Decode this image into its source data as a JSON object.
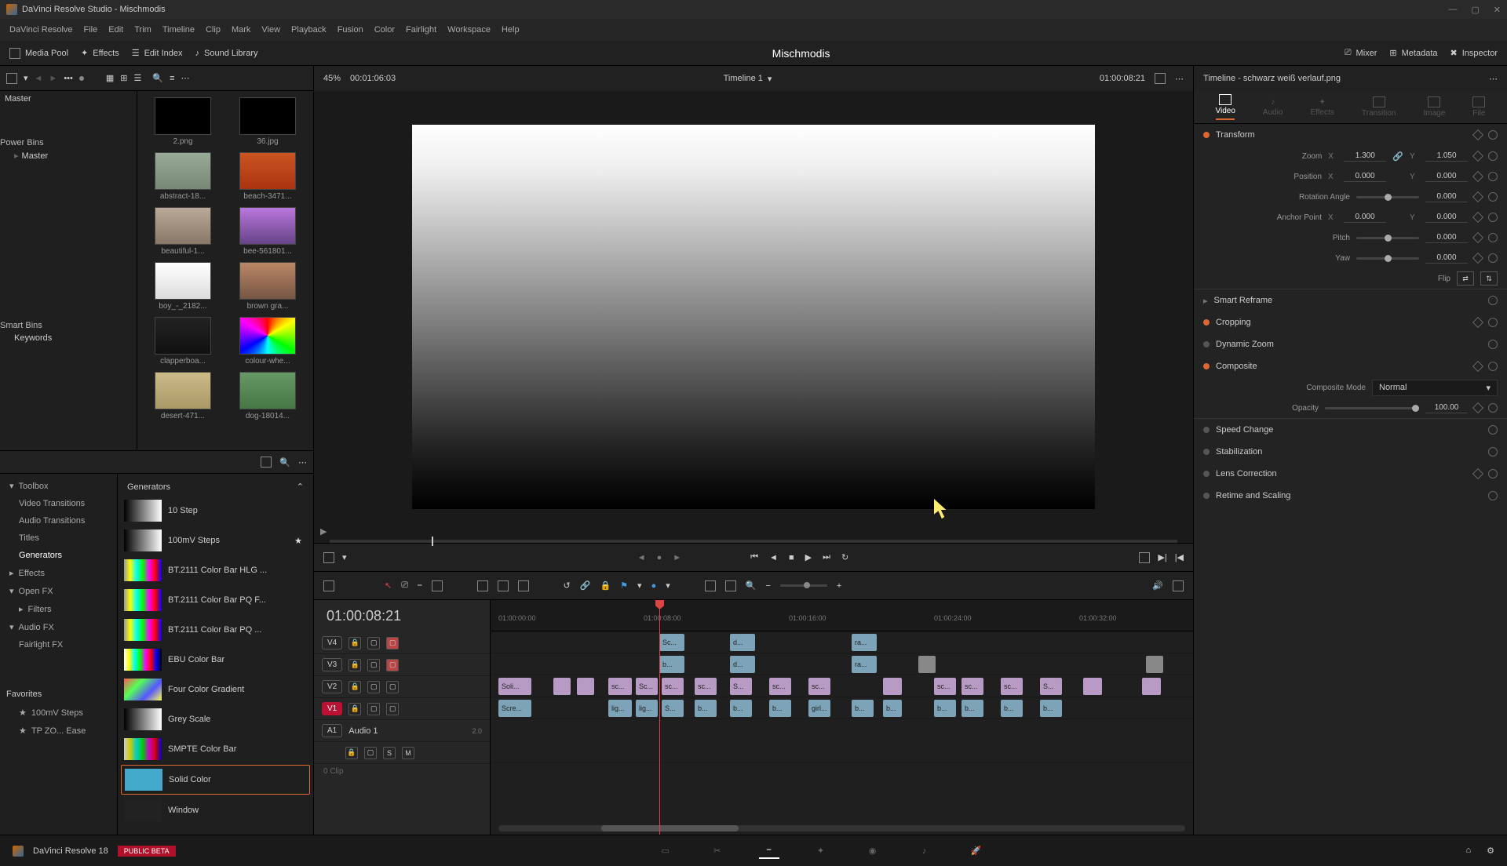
{
  "titlebar": {
    "title": "DaVinci Resolve Studio - Mischmodis"
  },
  "menubar": [
    "DaVinci Resolve",
    "File",
    "Edit",
    "Trim",
    "Timeline",
    "Clip",
    "Mark",
    "View",
    "Playback",
    "Fusion",
    "Color",
    "Fairlight",
    "Workspace",
    "Help"
  ],
  "toolbar": {
    "media_pool": "Media Pool",
    "effects": "Effects",
    "edit_index": "Edit Index",
    "sound_library": "Sound Library",
    "project_title": "Mischmodis",
    "mixer": "Mixer",
    "metadata": "Metadata",
    "inspector": "Inspector"
  },
  "viewer": {
    "zoom_pct": "45%",
    "in_tc": "00:01:06:03",
    "timeline_name": "Timeline 1",
    "playhead_tc": "01:00:08:21",
    "clip_name": "Timeline - schwarz weiß verlauf.png"
  },
  "media_tree": {
    "root": "Master",
    "power_bins": "Power Bins",
    "power_master": "Master",
    "smart_bins": "Smart Bins",
    "keywords": "Keywords"
  },
  "thumbs": [
    {
      "label": "2.png",
      "bg": "linear-gradient(#000,#000)"
    },
    {
      "label": "36.jpg",
      "bg": "linear-gradient(#000,#000)"
    },
    {
      "label": "abstract-18...",
      "bg": "linear-gradient(#9a9,#787)"
    },
    {
      "label": "beach-3471...",
      "bg": "linear-gradient(#c52,#a31)"
    },
    {
      "label": "beautiful-1...",
      "bg": "linear-gradient(#ba9,#876)"
    },
    {
      "label": "bee-561801...",
      "bg": "linear-gradient(#b7d,#648)"
    },
    {
      "label": "boy_-_2182...",
      "bg": "linear-gradient(#fff,#ddd)"
    },
    {
      "label": "brown gra...",
      "bg": "linear-gradient(#b86,#754)"
    },
    {
      "label": "clapperboa...",
      "bg": "linear-gradient(#222,#111)"
    },
    {
      "label": "colour-whe...",
      "bg": "conic-gradient(red,yellow,lime,cyan,blue,magenta,red)"
    },
    {
      "label": "desert-471...",
      "bg": "linear-gradient(#cb8,#a96)"
    },
    {
      "label": "dog-18014...",
      "bg": "linear-gradient(#696,#474)"
    }
  ],
  "fx_tree": {
    "toolbox": "Toolbox",
    "video_trans": "Video Transitions",
    "audio_trans": "Audio Transitions",
    "titles": "Titles",
    "generators": "Generators",
    "effects": "Effects",
    "open_fx": "Open FX",
    "filters": "Filters",
    "audio_fx": "Audio FX",
    "fairlight_fx": "Fairlight FX",
    "favorites": "Favorites",
    "fav1": "100mV Steps",
    "fav2": "TP ZO... Ease"
  },
  "generators": {
    "header": "Generators",
    "items": [
      {
        "name": "10 Step",
        "grad": "linear-gradient(90deg,#000,#fff)"
      },
      {
        "name": "100mV Steps",
        "grad": "linear-gradient(90deg,#000,#fff)",
        "star": true
      },
      {
        "name": "BT.2111 Color Bar HLG ...",
        "grad": "linear-gradient(90deg,#999,#ff0,#0ff,#0f0,#f0f,#f00,#00f)"
      },
      {
        "name": "BT.2111 Color Bar PQ F...",
        "grad": "linear-gradient(90deg,#999,#ff0,#0ff,#0f0,#f0f,#f00,#00f)"
      },
      {
        "name": "BT.2111 Color Bar PQ ...",
        "grad": "linear-gradient(90deg,#999,#ff0,#0ff,#0f0,#f0f,#f00,#00f)"
      },
      {
        "name": "EBU Color Bar",
        "grad": "linear-gradient(90deg,#fff,#ff0,#0ff,#0f0,#f0f,#f00,#00f,#000)"
      },
      {
        "name": "Four Color Gradient",
        "grad": "linear-gradient(135deg,#f55,#5f5,#55f,#ff5)"
      },
      {
        "name": "Grey Scale",
        "grad": "linear-gradient(90deg,#000,#fff)"
      },
      {
        "name": "SMPTE Color Bar",
        "grad": "linear-gradient(90deg,#ccc,#cc0,#0cc,#0c0,#c0c,#c00,#00c)"
      },
      {
        "name": "Solid Color",
        "grad": "linear-gradient(#4ac,#4ac)",
        "selected": true
      },
      {
        "name": "Window",
        "grad": "linear-gradient(#222,#222)"
      }
    ]
  },
  "timeline": {
    "big_tc": "01:00:08:21",
    "ruler": [
      "01:00:00:00",
      "01:00:08:00",
      "01:00:16:00",
      "01:00:24:00",
      "01:00:32:00"
    ],
    "tracks": {
      "v4": "V4",
      "v3": "V3",
      "v2": "V2",
      "v1": "V1",
      "a1": "A1",
      "audio1": "Audio 1",
      "a1_ch": "2.0"
    },
    "empty_clip": "0 Clip"
  },
  "inspector": {
    "tabs": [
      "Video",
      "Audio",
      "Effects",
      "Transition",
      "Image",
      "File"
    ],
    "transform": "Transform",
    "zoom": "Zoom",
    "position": "Position",
    "rotation": "Rotation Angle",
    "anchor": "Anchor Point",
    "pitch": "Pitch",
    "yaw": "Yaw",
    "flip": "Flip",
    "zoom_x": "1.300",
    "zoom_y": "1.050",
    "pos_x": "0.000",
    "pos_y": "0.000",
    "rot_val": "0.000",
    "anchor_x": "0.000",
    "anchor_y": "0.000",
    "pitch_val": "0.000",
    "yaw_val": "0.000",
    "smart_reframe": "Smart Reframe",
    "cropping": "Cropping",
    "dynamic_zoom": "Dynamic Zoom",
    "composite": "Composite",
    "composite_mode": "Composite Mode",
    "composite_mode_val": "Normal",
    "opacity": "Opacity",
    "opacity_val": "100.00",
    "speed": "Speed Change",
    "stabilization": "Stabilization",
    "lens": "Lens Correction",
    "retime": "Retime and Scaling",
    "x": "X",
    "y": "Y"
  },
  "bottom": {
    "app": "DaVinci Resolve 18",
    "beta": "PUBLIC BETA"
  }
}
